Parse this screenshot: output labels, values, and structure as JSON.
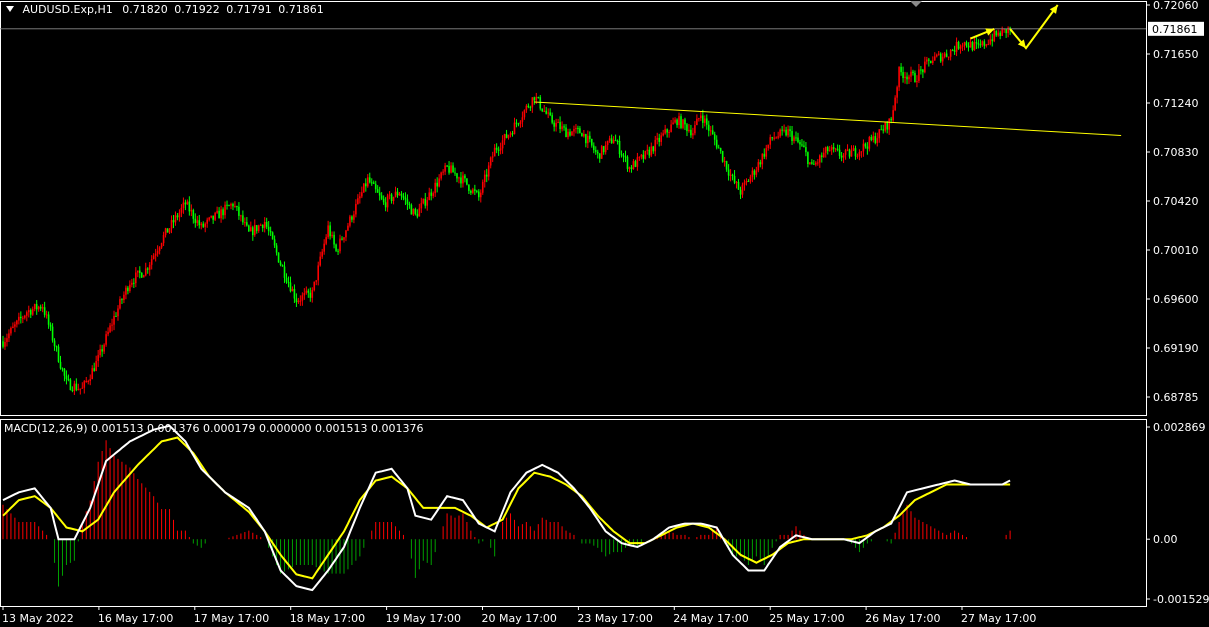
{
  "header": {
    "symbol": "AUDUSD.Exp,H1",
    "open": "0.71820",
    "high": "0.71922",
    "low": "0.71791",
    "close": "0.71861"
  },
  "macd_header": {
    "label": "MACD(12,26,9)",
    "values": "0.001513 0.001376 0.000179 0.000000 0.001513 0.001376"
  },
  "colors": {
    "background": "#000000",
    "bull": "#ff0000",
    "bear": "#00ff00",
    "grid": "#ffffff",
    "signal": "#ffff00",
    "macd": "#ffffff",
    "hist_pos": "#ff0000",
    "hist_neg": "#00a000",
    "trendline": "#ffff00"
  },
  "chart_data": [
    {
      "type": "candlestick",
      "symbol": "AUDUSD.Exp",
      "timeframe": "H1",
      "current_price": 0.71861,
      "current_price_label": "0.71861",
      "y_tick_labels": [
        "0.72060",
        "0.71650",
        "0.71240",
        "0.70830",
        "0.70420",
        "0.70010",
        "0.69600",
        "0.69190",
        "0.68785"
      ],
      "ylim": [
        0.68785,
        0.7206
      ],
      "x_tick_labels": [
        "13 May 2022",
        "16 May 17:00",
        "17 May 17:00",
        "18 May 17:00",
        "19 May 17:00",
        "20 May 17:00",
        "23 May 17:00",
        "24 May 17:00",
        "25 May 17:00",
        "26 May 17:00",
        "27 May 17:00"
      ],
      "price_path": [
        [
          0,
          0.6925
        ],
        [
          3,
          0.695
        ],
        [
          5,
          0.6955
        ],
        [
          8,
          0.689
        ],
        [
          10,
          0.6885
        ],
        [
          12,
          0.691
        ],
        [
          14,
          0.6945
        ],
        [
          16,
          0.6975
        ],
        [
          18,
          0.6985
        ],
        [
          20,
          0.701
        ],
        [
          22,
          0.703
        ],
        [
          23,
          0.704
        ],
        [
          25,
          0.702
        ],
        [
          27,
          0.703
        ],
        [
          29,
          0.704
        ],
        [
          31,
          0.7015
        ],
        [
          33,
          0.7025
        ],
        [
          35,
          0.699
        ],
        [
          37,
          0.696
        ],
        [
          39,
          0.6965
        ],
        [
          41,
          0.702
        ],
        [
          42,
          0.7
        ],
        [
          44,
          0.703
        ],
        [
          46,
          0.706
        ],
        [
          48,
          0.704
        ],
        [
          50,
          0.705
        ],
        [
          52,
          0.703
        ],
        [
          54,
          0.705
        ],
        [
          56,
          0.707
        ],
        [
          58,
          0.706
        ],
        [
          60,
          0.7045
        ],
        [
          62,
          0.7085
        ],
        [
          64,
          0.71
        ],
        [
          66,
          0.712
        ],
        [
          67,
          0.713
        ],
        [
          69,
          0.711
        ],
        [
          71,
          0.71
        ],
        [
          73,
          0.71
        ],
        [
          75,
          0.708
        ],
        [
          77,
          0.7095
        ],
        [
          79,
          0.707
        ],
        [
          81,
          0.708
        ],
        [
          83,
          0.7095
        ],
        [
          85,
          0.711
        ],
        [
          87,
          0.71
        ],
        [
          88,
          0.7115
        ],
        [
          90,
          0.709
        ],
        [
          92,
          0.706
        ],
        [
          93,
          0.705
        ],
        [
          95,
          0.707
        ],
        [
          97,
          0.7095
        ],
        [
          99,
          0.71
        ],
        [
          101,
          0.7085
        ],
        [
          102,
          0.707
        ],
        [
          104,
          0.7085
        ],
        [
          106,
          0.708
        ],
        [
          108,
          0.7085
        ],
        [
          110,
          0.7095
        ],
        [
          112,
          0.711
        ],
        [
          113,
          0.715
        ],
        [
          115,
          0.7145
        ],
        [
          117,
          0.716
        ],
        [
          119,
          0.7165
        ],
        [
          121,
          0.7175
        ],
        [
          123,
          0.717
        ],
        [
          125,
          0.718
        ],
        [
          127,
          0.7186
        ]
      ],
      "trendline": {
        "start": [
          67,
          0.7125
        ],
        "end": [
          141,
          0.7097
        ]
      },
      "forecast_arrows": [
        [
          127,
          0.7186
        ],
        [
          129,
          0.717
        ],
        [
          133,
          0.7206
        ]
      ],
      "small_arrow": [
        [
          122,
          0.7178
        ],
        [
          125,
          0.7186
        ]
      ]
    },
    {
      "type": "line",
      "indicator": "MACD(12,26,9)",
      "y_tick_labels": [
        "0.002869",
        "0.00",
        "-0.001529"
      ],
      "ylim": [
        -0.001529,
        0.002869
      ],
      "series": [
        {
          "values": [
            [
              0,
              0.001
            ],
            [
              2,
              0.0012
            ],
            [
              4,
              0.0013
            ],
            [
              6,
              0.0008
            ],
            [
              7,
              0.0
            ],
            [
              9,
              0.0
            ],
            [
              11,
              0.0008
            ],
            [
              13,
              0.002
            ],
            [
              16,
              0.0025
            ],
            [
              19,
              0.0028
            ],
            [
              21,
              0.0029
            ],
            [
              23,
              0.0025
            ],
            [
              25,
              0.0018
            ],
            [
              28,
              0.0012
            ],
            [
              31,
              0.0008
            ],
            [
              33,
              0.0002
            ],
            [
              35,
              -0.0008
            ],
            [
              37,
              -0.0012
            ],
            [
              39,
              -0.0013
            ],
            [
              41,
              -0.0008
            ],
            [
              43,
              -0.0002
            ],
            [
              45,
              0.0008
            ],
            [
              47,
              0.0017
            ],
            [
              49,
              0.0018
            ],
            [
              51,
              0.0013
            ],
            [
              52,
              0.0006
            ],
            [
              54,
              0.0005
            ],
            [
              56,
              0.0011
            ],
            [
              58,
              0.001
            ],
            [
              60,
              0.0004
            ],
            [
              62,
              0.0002
            ],
            [
              64,
              0.0012
            ],
            [
              66,
              0.0017
            ],
            [
              68,
              0.0019
            ],
            [
              70,
              0.0017
            ],
            [
              72,
              0.0013
            ],
            [
              74,
              0.0008
            ],
            [
              76,
              0.0002
            ],
            [
              78,
              -0.0001
            ],
            [
              80,
              -0.0002
            ],
            [
              82,
              0.0
            ],
            [
              84,
              0.0003
            ],
            [
              86,
              0.0004
            ],
            [
              88,
              0.0004
            ],
            [
              90,
              0.0003
            ],
            [
              92,
              -0.0004
            ],
            [
              94,
              -0.0008
            ],
            [
              96,
              -0.0008
            ],
            [
              98,
              -0.0002
            ],
            [
              100,
              0.0001
            ],
            [
              102,
              0.0
            ],
            [
              104,
              0.0
            ],
            [
              106,
              0.0
            ],
            [
              108,
              -0.0001
            ],
            [
              110,
              0.0002
            ],
            [
              112,
              0.0004
            ],
            [
              114,
              0.0012
            ],
            [
              116,
              0.0013
            ],
            [
              118,
              0.0014
            ],
            [
              120,
              0.0015
            ],
            [
              122,
              0.0014
            ],
            [
              124,
              0.0014
            ],
            [
              126,
              0.0014
            ],
            [
              127,
              0.0015
            ]
          ]
        },
        {
          "values": [
            [
              0,
              0.0006
            ],
            [
              2,
              0.001
            ],
            [
              4,
              0.0011
            ],
            [
              6,
              0.0008
            ],
            [
              8,
              0.0003
            ],
            [
              10,
              0.0002
            ],
            [
              12,
              0.0005
            ],
            [
              14,
              0.0012
            ],
            [
              17,
              0.0019
            ],
            [
              20,
              0.0025
            ],
            [
              22,
              0.0026
            ],
            [
              24,
              0.0022
            ],
            [
              26,
              0.0016
            ],
            [
              28,
              0.0012
            ],
            [
              31,
              0.0007
            ],
            [
              33,
              0.0002
            ],
            [
              35,
              -0.0004
            ],
            [
              37,
              -0.0009
            ],
            [
              39,
              -0.001
            ],
            [
              41,
              -0.0004
            ],
            [
              43,
              0.0002
            ],
            [
              45,
              0.001
            ],
            [
              47,
              0.0015
            ],
            [
              49,
              0.0016
            ],
            [
              51,
              0.0013
            ],
            [
              53,
              0.0008
            ],
            [
              55,
              0.0008
            ],
            [
              57,
              0.0008
            ],
            [
              59,
              0.0006
            ],
            [
              61,
              0.0003
            ],
            [
              63,
              0.0005
            ],
            [
              65,
              0.0013
            ],
            [
              67,
              0.0017
            ],
            [
              69,
              0.0016
            ],
            [
              71,
              0.0014
            ],
            [
              73,
              0.0011
            ],
            [
              75,
              0.0006
            ],
            [
              77,
              0.0002
            ],
            [
              79,
              -0.0001
            ],
            [
              81,
              -0.0001
            ],
            [
              83,
              0.0001
            ],
            [
              85,
              0.0003
            ],
            [
              87,
              0.0004
            ],
            [
              89,
              0.0003
            ],
            [
              91,
              0.0
            ],
            [
              93,
              -0.0004
            ],
            [
              95,
              -0.0006
            ],
            [
              97,
              -0.0004
            ],
            [
              99,
              -0.0001
            ],
            [
              101,
              0.0
            ],
            [
              103,
              0.0
            ],
            [
              105,
              0.0
            ],
            [
              107,
              0.0
            ],
            [
              109,
              0.0001
            ],
            [
              111,
              0.0003
            ],
            [
              113,
              0.0006
            ],
            [
              115,
              0.001
            ],
            [
              117,
              0.0012
            ],
            [
              119,
              0.0014
            ],
            [
              121,
              0.0014
            ],
            [
              123,
              0.0014
            ],
            [
              125,
              0.0014
            ],
            [
              127,
              0.0014
            ]
          ]
        }
      ]
    }
  ]
}
